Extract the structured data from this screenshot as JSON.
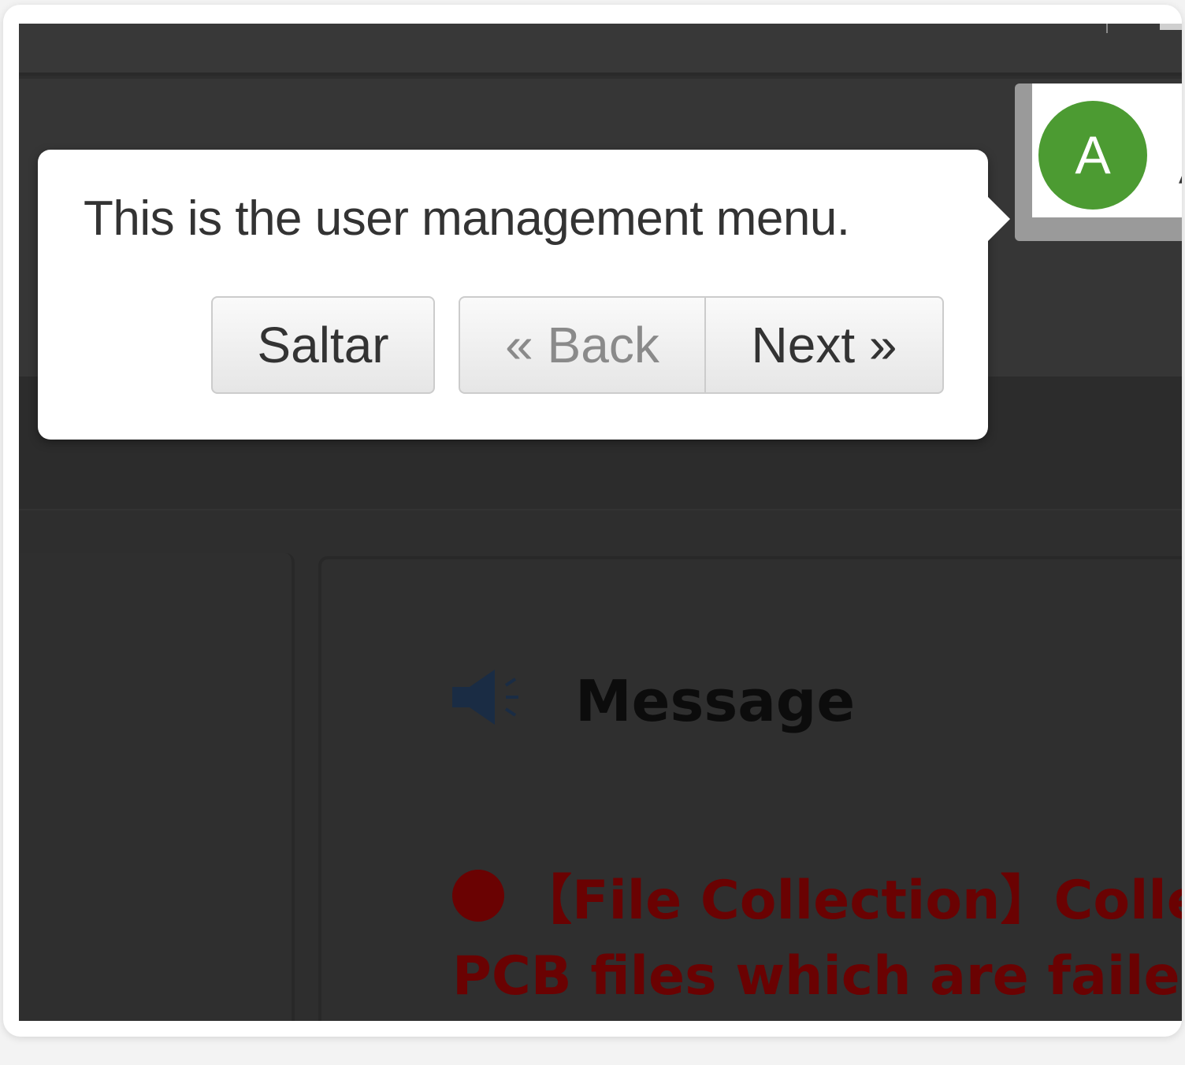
{
  "tour": {
    "text": "This is the user management menu.",
    "skip_label": "Saltar",
    "back_label": "« Back",
    "next_label": "Next »"
  },
  "user": {
    "avatar_letter": "A",
    "avatar_color": "#4c9b32",
    "name_peek": "A"
  },
  "message": {
    "heading": "Message",
    "icon": "megaphone-icon",
    "notice_line1": "【File Collection】Colle",
    "notice_line2": "PCB files which are failed",
    "notice_color": "#6a0202"
  }
}
